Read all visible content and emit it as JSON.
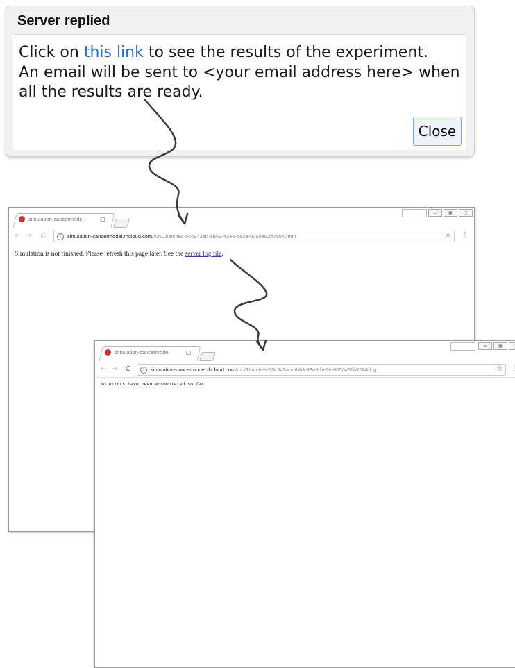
{
  "dialog": {
    "title": "Server replied",
    "message_prefix": "Click on ",
    "link_text": "this link",
    "message_suffix": " to see the results of the experiment.",
    "message_line2": "An email will be sent to <your email address here> when",
    "message_line3": "all the results are ready.",
    "close_label": "Close"
  },
  "browser1": {
    "tab_title": "simulation-cancermodel.",
    "tab_close": "×",
    "url_host": "simulation-cancermodel.rhcloud.com",
    "url_path": "/run/1batches-50c943ab-ab63-43e6-be2e-0050a62b7584.html",
    "content_text": "Simulation is not finished. Please refresh this page later. See the ",
    "content_link": "server log file",
    "content_end": "."
  },
  "browser2": {
    "tab_title": "simulation-cancermode",
    "tab_close": "×",
    "url_host": "simulation-cancermodel.rhcloud.com",
    "url_path": "/run/1batches-50c943ab-ab63-43e6-be2e-0050a62b7584.log",
    "content_text": "No errors have been encountered so far."
  },
  "icons": {
    "back": "←",
    "forward": "→",
    "reload": "C",
    "info": "i",
    "star": "☆",
    "menu": "⋮",
    "minimize": "▭",
    "restore": "▣",
    "close": "▢"
  }
}
